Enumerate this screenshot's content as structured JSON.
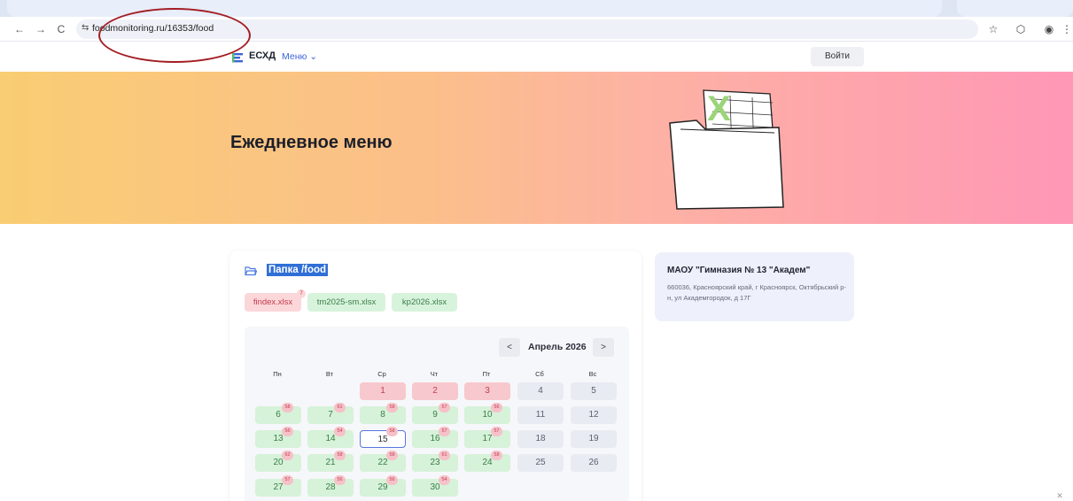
{
  "browser": {
    "url": "foodmonitoring.ru/16353/food",
    "back_icon": "arrow-left-icon",
    "forward_icon": "arrow-right-icon",
    "reload_icon": "reload-icon",
    "back_glyph": "←",
    "forward_glyph": "→",
    "reload_glyph": "C",
    "site_info_glyph": "⇆",
    "star_glyph": "☆",
    "ext_glyph": "⬡",
    "profile_glyph": "◉",
    "more_glyph": "⋮"
  },
  "header": {
    "logo_text": "ЕСХД",
    "menu_label": "Меню ⌄",
    "login_label": "Войти"
  },
  "banner": {
    "title": "Ежедневное меню",
    "folder_mark": "X"
  },
  "folder": {
    "label": "Папка /food",
    "files": [
      {
        "name": "findex.xlsx",
        "badge": "7",
        "status": "red"
      },
      {
        "name": "tm2025-sm.xlsx",
        "status": "green"
      },
      {
        "name": "kp2026.xlsx",
        "status": "green"
      }
    ]
  },
  "calendar": {
    "prev_label": "<",
    "next_label": ">",
    "month": "Апрель 2026",
    "weekdays": [
      "Пн",
      "Вт",
      "Ср",
      "Чт",
      "Пт",
      "Сб",
      "Вс"
    ],
    "days": [
      {
        "d": "1",
        "status": "red"
      },
      {
        "d": "2",
        "status": "red"
      },
      {
        "d": "3",
        "status": "red"
      },
      {
        "d": "4",
        "status": "weekend"
      },
      {
        "d": "5",
        "status": "weekend"
      },
      {
        "d": "6",
        "status": "green",
        "badge": "58"
      },
      {
        "d": "7",
        "status": "green",
        "badge": "61"
      },
      {
        "d": "8",
        "status": "green",
        "badge": "58"
      },
      {
        "d": "9",
        "status": "green",
        "badge": "57"
      },
      {
        "d": "10",
        "status": "green",
        "badge": "56"
      },
      {
        "d": "11",
        "status": "weekend"
      },
      {
        "d": "12",
        "status": "weekend"
      },
      {
        "d": "13",
        "status": "green",
        "badge": "56"
      },
      {
        "d": "14",
        "status": "green",
        "badge": "54"
      },
      {
        "d": "15",
        "status": "selected",
        "badge": "58"
      },
      {
        "d": "16",
        "status": "green",
        "badge": "57"
      },
      {
        "d": "17",
        "status": "green",
        "badge": "57"
      },
      {
        "d": "18",
        "status": "weekend"
      },
      {
        "d": "19",
        "status": "weekend"
      },
      {
        "d": "20",
        "status": "green",
        "badge": "62"
      },
      {
        "d": "21",
        "status": "green",
        "badge": "58"
      },
      {
        "d": "22",
        "status": "green",
        "badge": "58"
      },
      {
        "d": "23",
        "status": "green",
        "badge": "61"
      },
      {
        "d": "24",
        "status": "green",
        "badge": "58"
      },
      {
        "d": "25",
        "status": "weekend"
      },
      {
        "d": "26",
        "status": "weekend"
      },
      {
        "d": "27",
        "status": "green",
        "badge": "57"
      },
      {
        "d": "28",
        "status": "green",
        "badge": "56"
      },
      {
        "d": "29",
        "status": "green",
        "badge": "56"
      },
      {
        "d": "30",
        "status": "green",
        "badge": "54"
      }
    ]
  },
  "school": {
    "name": "МАОУ \"Гимназия № 13 \"Академ\"",
    "address": "660036, Красноярский край, г Красноярск, Октябрьский р-н, ул Академгородок, д 17Г"
  },
  "colors": {
    "accent": "#3e64d8",
    "banner_start": "#f9cd73",
    "banner_end": "#ff97b6",
    "ok_green": "#d6f2d9",
    "alert_red": "#f7c8cd",
    "annotation_oval": "#a31d24"
  }
}
